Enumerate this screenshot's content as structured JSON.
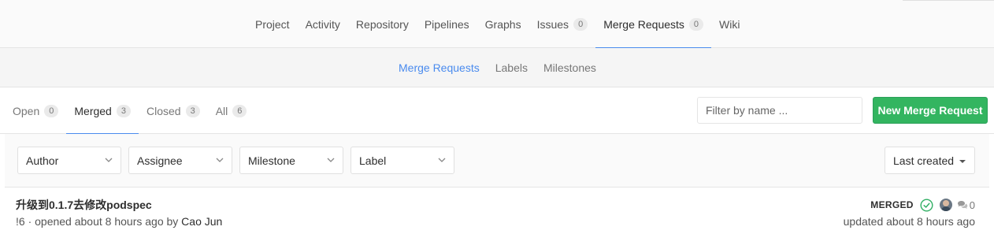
{
  "top_nav": {
    "items": [
      {
        "label": "Project"
      },
      {
        "label": "Activity"
      },
      {
        "label": "Repository"
      },
      {
        "label": "Pipelines"
      },
      {
        "label": "Graphs"
      },
      {
        "label": "Issues",
        "count": "0"
      },
      {
        "label": "Merge Requests",
        "count": "0",
        "active": true
      },
      {
        "label": "Wiki"
      }
    ]
  },
  "sub_nav": {
    "items": [
      {
        "label": "Merge Requests",
        "active": true
      },
      {
        "label": "Labels"
      },
      {
        "label": "Milestones"
      }
    ]
  },
  "state_tabs": [
    {
      "label": "Open",
      "count": "0"
    },
    {
      "label": "Merged",
      "count": "3",
      "active": true
    },
    {
      "label": "Closed",
      "count": "3"
    },
    {
      "label": "All",
      "count": "6"
    }
  ],
  "filter": {
    "placeholder": "Filter by name ..."
  },
  "new_button": {
    "label": "New Merge Request"
  },
  "dropdowns": {
    "author": "Author",
    "assignee": "Assignee",
    "milestone": "Milestone",
    "label": "Label",
    "sort": "Last created"
  },
  "merge_requests": [
    {
      "title": "升级到0.1.7去修改podspec",
      "iid": "!6",
      "opened_text": " · opened about 8 hours ago by ",
      "author": "Cao Jun",
      "status": "MERGED",
      "comments": "0",
      "updated": "updated about 8 hours ago"
    }
  ],
  "colors": {
    "accent": "#4a8bee",
    "success": "#33b560",
    "ci_success": "#31af64"
  }
}
